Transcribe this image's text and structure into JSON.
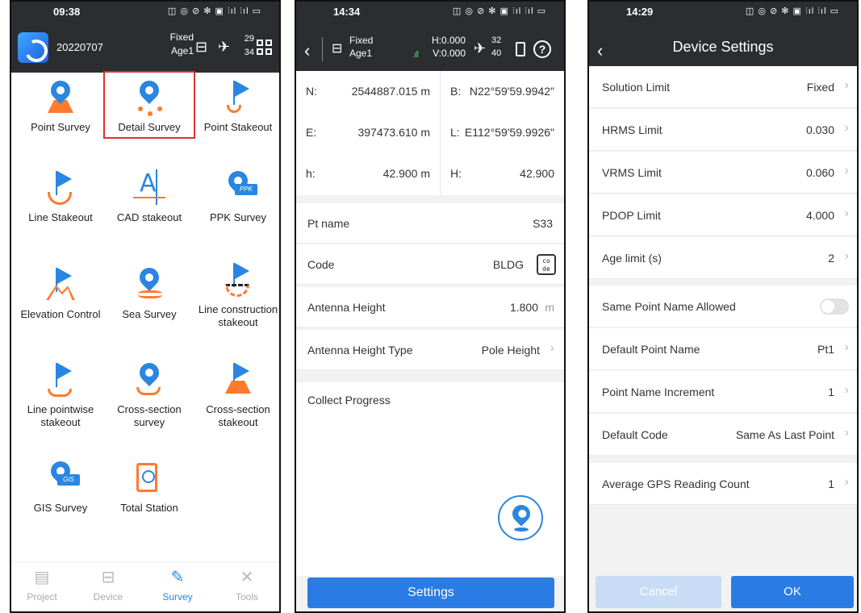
{
  "phone1": {
    "status": {
      "time": "09:38",
      "icons": "◫ ◎ ⊘ ✻ ▣ ⫶ıl ⫶ıl ▭"
    },
    "header": {
      "project": "20220707",
      "fix_status": "Fixed",
      "age": "Age1",
      "sat_top": "29",
      "sat_bottom": "34",
      "grid_icon": "apps-grid-icon"
    },
    "tiles": [
      {
        "label": "Point Survey"
      },
      {
        "label": "Detail Survey"
      },
      {
        "label": "Point Stakeout"
      },
      {
        "label": "Line Stakeout"
      },
      {
        "label": "CAD stakeout"
      },
      {
        "label": "PPK Survey",
        "tag": "PPK"
      },
      {
        "label": "Elevation Control"
      },
      {
        "label": "Sea Survey"
      },
      {
        "label": "Line construction stakeout"
      },
      {
        "label": "Line pointwise stakeout"
      },
      {
        "label": "Cross-section survey"
      },
      {
        "label": "Cross-section stakeout"
      },
      {
        "label": "GIS Survey",
        "tag": "GIS"
      },
      {
        "label": "Total Station"
      }
    ],
    "selected_tile": "Detail Survey",
    "nav": [
      {
        "label": "Project",
        "icon": "project-icon"
      },
      {
        "label": "Device",
        "icon": "device-icon"
      },
      {
        "label": "Survey",
        "icon": "survey-icon",
        "active": true
      },
      {
        "label": "Tools",
        "icon": "tools-icon"
      }
    ],
    "colors": {
      "accent": "#2a86e0",
      "secondary": "#ff7a2f",
      "header": "#2c2d31",
      "selected_outline": "#e03030"
    }
  },
  "phone2": {
    "status": {
      "time": "14:34",
      "icons": "◫ ◎ ⊘ ✻ ▣ ⫶ıl ⫶ıl ▭"
    },
    "header": {
      "fix_status": "Fixed",
      "age": "Age1",
      "h_precision": "H:0.000",
      "v_precision": "V:0.000",
      "sat_top": "32",
      "sat_bottom": "40",
      "help": "?"
    },
    "coords": [
      {
        "key": "N:",
        "value": "2544887.015 m"
      },
      {
        "key": "B:",
        "value": "N22°59'59.9942\""
      },
      {
        "key": "E:",
        "value": "397473.610 m"
      },
      {
        "key": "L:",
        "value": "E112°59'59.9926\""
      },
      {
        "key": "h:",
        "value": "42.900 m"
      },
      {
        "key": "H:",
        "value": "42.900"
      }
    ],
    "fields": {
      "pt_name": {
        "label": "Pt name",
        "value": "S33"
      },
      "code": {
        "label": "Code",
        "value": "BLDG",
        "icon_text": "co de"
      },
      "antenna_height": {
        "label": "Antenna Height",
        "value": "1.800",
        "unit": "m"
      },
      "antenna_height_type": {
        "label": "Antenna Height Type",
        "value": "Pole Height"
      }
    },
    "collect_progress": "Collect Progress",
    "settings_button": "Settings"
  },
  "phone3": {
    "status": {
      "time": "14:29",
      "icons": "◫ ◎ ⊘ ✻ ▣ ⫶ıl ⫶ıl ▭"
    },
    "title": "Device Settings",
    "group1": [
      {
        "label": "Solution Limit",
        "value": "Fixed"
      },
      {
        "label": "HRMS Limit",
        "value": "0.030"
      },
      {
        "label": "VRMS Limit",
        "value": "0.060"
      },
      {
        "label": "PDOP Limit",
        "value": "4.000"
      },
      {
        "label": "Age limit (s)",
        "value": "2"
      }
    ],
    "group2": {
      "same_point_name": {
        "label": "Same Point Name Allowed",
        "enabled": false
      },
      "default_point_name": {
        "label": "Default Point Name",
        "value": "Pt1"
      },
      "point_name_increment": {
        "label": "Point Name Increment",
        "value": "1"
      },
      "default_code": {
        "label": "Default Code",
        "value": "Same As Last Point"
      }
    },
    "group3": {
      "avg_gps": {
        "label": "Average GPS Reading Count",
        "value": "1"
      }
    },
    "buttons": {
      "cancel": "Cancel",
      "ok": "OK"
    }
  },
  "glyphs": {
    "back": "‹",
    "chevron": "›"
  }
}
